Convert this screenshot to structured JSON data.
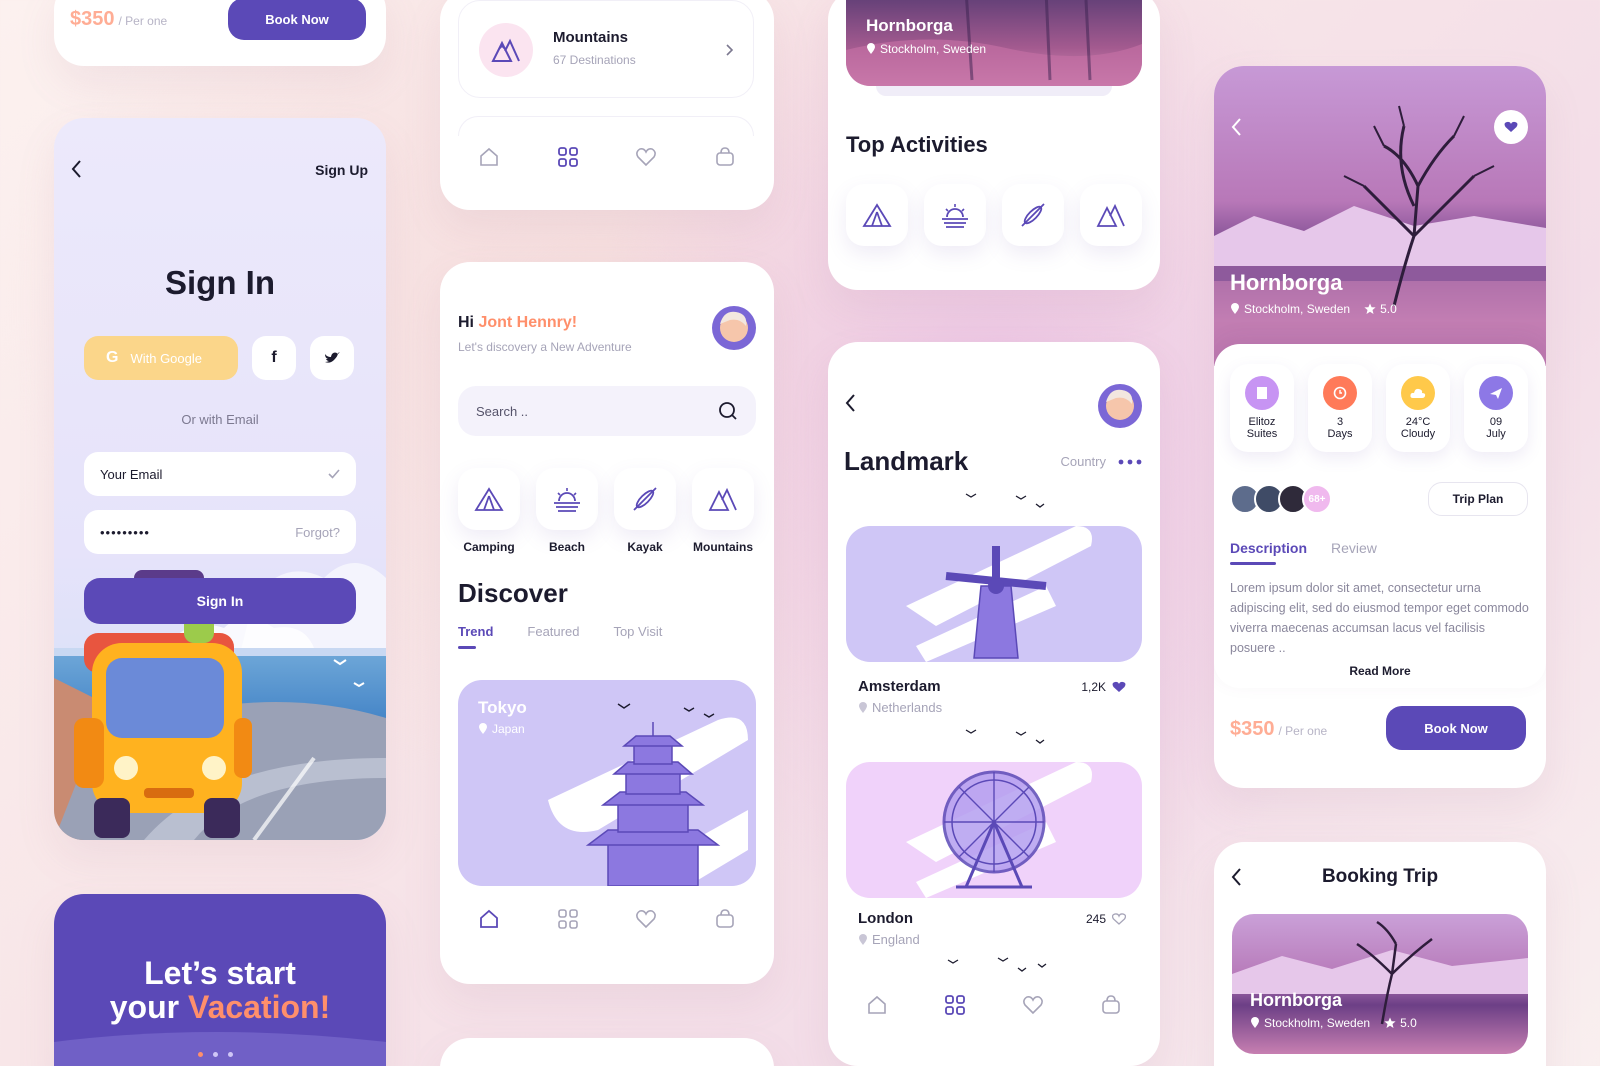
{
  "price_top": {
    "price": "$350",
    "per": "/ Per one",
    "book": "Book Now"
  },
  "signin": {
    "signup": "Sign Up",
    "title": "Sign In",
    "google": "With Google",
    "or": "Or with Email",
    "email_placeholder": "Your Email",
    "password_value": "•••••••••",
    "forgot": "Forgot?",
    "submit": "Sign In"
  },
  "vacation": {
    "line1": "Let’s start",
    "line2a": "your ",
    "line2b": "Vacation!"
  },
  "mountains_card": {
    "title": "Mountains",
    "subtitle": "67 Destinations"
  },
  "home": {
    "hi": "Hi ",
    "name": "Jont Hennry!",
    "tagline": "Let's discovery a New Adventure",
    "search_placeholder": "Search ..",
    "categories": [
      {
        "label": "Camping"
      },
      {
        "label": "Beach"
      },
      {
        "label": "Kayak"
      },
      {
        "label": "Mountains"
      }
    ],
    "discover": "Discover",
    "tabs": [
      {
        "label": "Trend"
      },
      {
        "label": "Featured"
      },
      {
        "label": "Top Visit"
      }
    ],
    "feature": {
      "city": "Tokyo",
      "country": "Japan"
    }
  },
  "activities": {
    "place": "Hornborga",
    "location": "Stockholm, Sweden",
    "title": "Top Activities"
  },
  "landmark": {
    "title": "Landmark",
    "country": "Country",
    "items": [
      {
        "name": "Amsterdam",
        "country": "Netherlands",
        "likes": "1,2K"
      },
      {
        "name": "London",
        "country": "England",
        "likes": "245"
      }
    ]
  },
  "detail": {
    "place": "Hornborga",
    "location": "Stockholm, Sweden",
    "rating": "5.0",
    "stats": [
      {
        "line1": "Elitoz",
        "line2": "Suites",
        "color": "#c794f3"
      },
      {
        "line1": "3",
        "line2": "Days",
        "color": "#ff7a59"
      },
      {
        "line1": "24°C",
        "line2": "Cloudy",
        "color": "#ffc94a"
      },
      {
        "line1": "09",
        "line2": "July",
        "color": "#8d78e6"
      }
    ],
    "more": "68+",
    "trip_plan": "Trip Plan",
    "tabs": [
      {
        "label": "Description"
      },
      {
        "label": "Review"
      }
    ],
    "description": "Lorem ipsum dolor sit amet, consectetur urna adipiscing elit, sed do eiusmod tempor eget commodo viverra maecenas accumsan lacus vel facilisis posuere ..",
    "read_more": "Read More",
    "price": "$350",
    "per": "/ Per one",
    "book": "Book Now"
  },
  "booking": {
    "title": "Booking Trip",
    "place": "Hornborga",
    "location": "Stockholm, Sweden",
    "rating": "5.0"
  },
  "colors": {
    "accent": "#5b49b7",
    "orange": "#ff8f6b",
    "lavender": "#cfc6f6",
    "pink": "#f0d2fa"
  }
}
